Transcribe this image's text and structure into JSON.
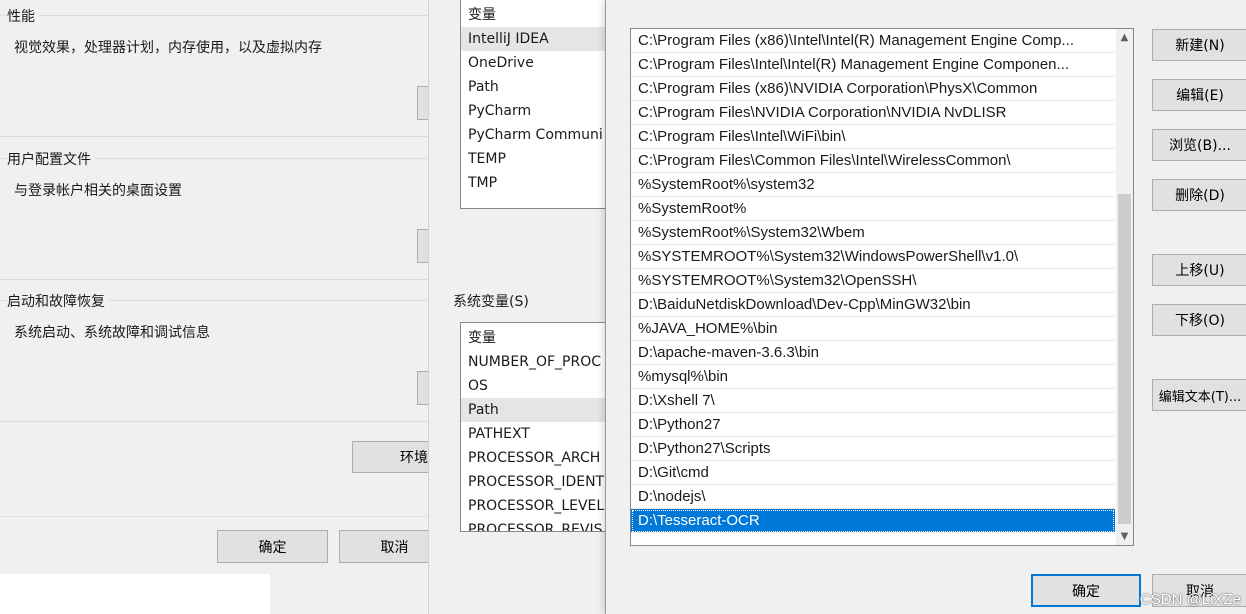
{
  "system_properties": {
    "groups": [
      {
        "title": "性能",
        "description": "视觉效果，处理器计划，内存使用，以及虚拟内存"
      },
      {
        "title": "用户配置文件",
        "description": "与登录帐户相关的桌面设置"
      },
      {
        "title": "启动和故障恢复",
        "description": "系统启动、系统故障和调试信息"
      }
    ],
    "env_button_label": "环境",
    "ok_label": "确定",
    "cancel_label": "取消"
  },
  "env_vars": {
    "user_vars": {
      "header": "变量",
      "rows": [
        "IntelliJ IDEA",
        "OneDrive",
        "Path",
        "PyCharm",
        "PyCharm Communi",
        "TEMP",
        "TMP"
      ],
      "selected": "IntelliJ IDEA"
    },
    "system_vars_label": "系统变量(S)",
    "system_vars": {
      "header": "变量",
      "rows": [
        "NUMBER_OF_PROC",
        "OS",
        "Path",
        "PATHEXT",
        "PROCESSOR_ARCH",
        "PROCESSOR_IDENT",
        "PROCESSOR_LEVEL",
        "PROCESSOR_REVIS"
      ],
      "selected": "Path"
    }
  },
  "edit_dialog": {
    "paths": [
      "C:\\Program Files (x86)\\Intel\\Intel(R) Management Engine Comp...",
      "C:\\Program Files\\Intel\\Intel(R) Management Engine Componen...",
      "C:\\Program Files (x86)\\NVIDIA Corporation\\PhysX\\Common",
      "C:\\Program Files\\NVIDIA Corporation\\NVIDIA NvDLISR",
      "C:\\Program Files\\Intel\\WiFi\\bin\\",
      "C:\\Program Files\\Common Files\\Intel\\WirelessCommon\\",
      "%SystemRoot%\\system32",
      "%SystemRoot%",
      "%SystemRoot%\\System32\\Wbem",
      "%SYSTEMROOT%\\System32\\WindowsPowerShell\\v1.0\\",
      "%SYSTEMROOT%\\System32\\OpenSSH\\",
      "D:\\BaiduNetdiskDownload\\Dev-Cpp\\MinGW32\\bin",
      "%JAVA_HOME%\\bin",
      "D:\\apache-maven-3.6.3\\bin",
      "%mysql%\\bin",
      "D:\\Xshell 7\\",
      "D:\\Python27",
      "D:\\Python27\\Scripts",
      "D:\\Git\\cmd",
      "D:\\nodejs\\",
      "D:\\Tesseract-OCR"
    ],
    "selected_index": 20,
    "buttons": {
      "new": "新建(N)",
      "edit": "编辑(E)",
      "browse": "浏览(B)...",
      "delete": "删除(D)",
      "move_up": "上移(U)",
      "move_down": "下移(O)",
      "edit_text": "编辑文本(T)..."
    },
    "ok_label": "确定",
    "cancel_label": "取消",
    "icons": {
      "scroll_up": "scroll-up-arrow-icon",
      "scroll_down": "scroll-down-arrow-icon"
    }
  },
  "watermark": "CSDN @LiXZe"
}
